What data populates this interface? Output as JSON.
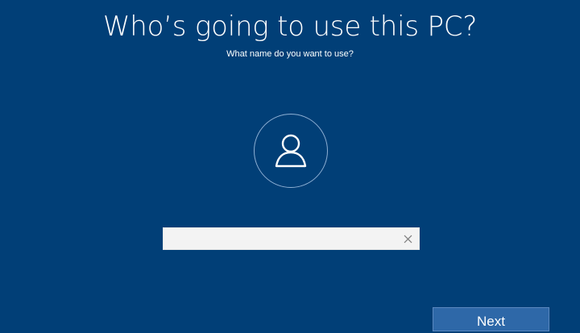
{
  "setup": {
    "title": "Who’s going to use this PC?",
    "subtitle": "What name do you want to use?"
  },
  "avatar": {
    "icon": "person-icon"
  },
  "name_field": {
    "value": "",
    "placeholder": "",
    "clear_icon": "close-icon"
  },
  "footer": {
    "next_label": "Next"
  },
  "colors": {
    "background": "#013f77",
    "button": "#2e68a8",
    "input_background": "#f3f3f3"
  }
}
